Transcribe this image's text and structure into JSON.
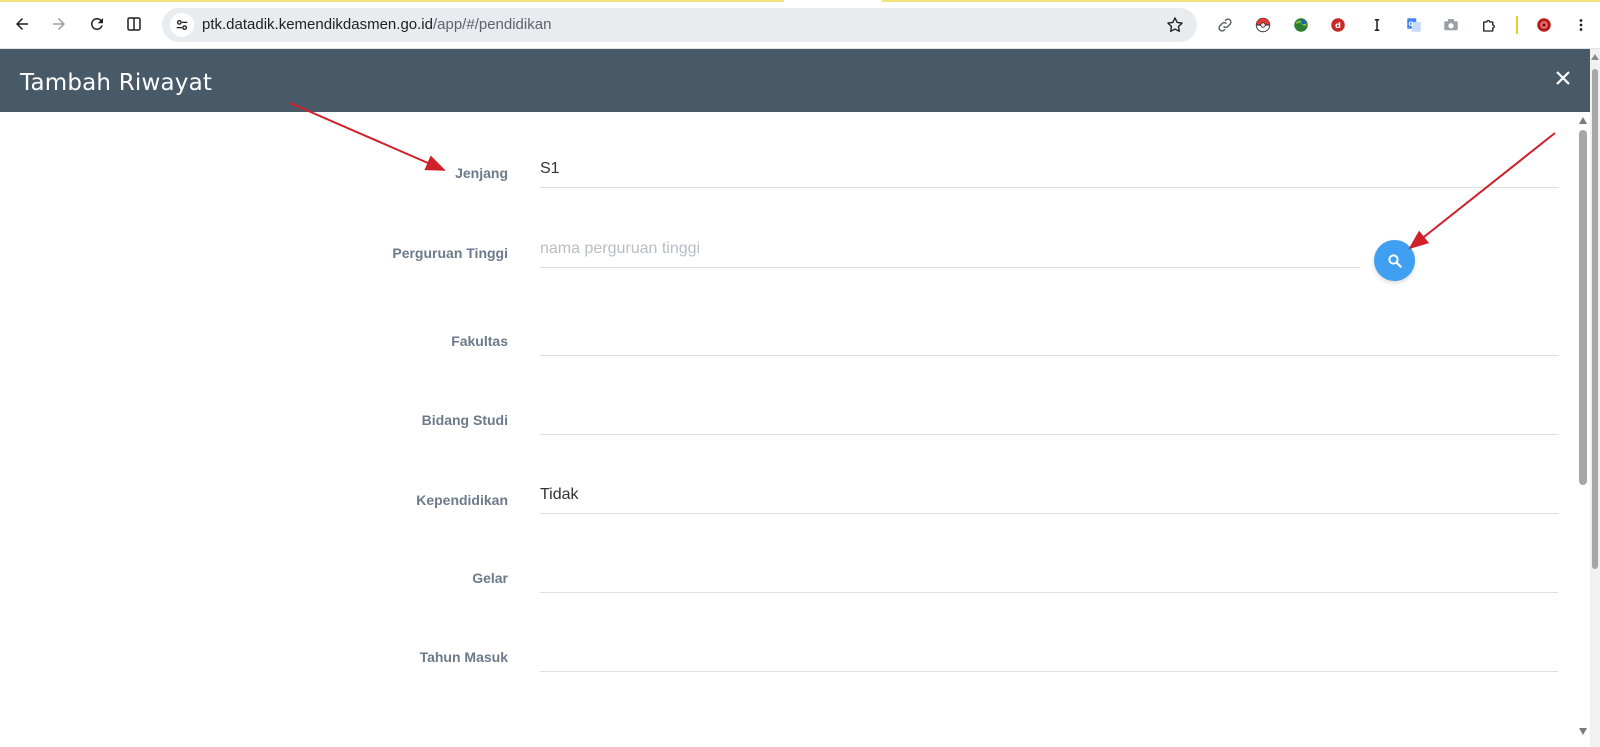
{
  "browser": {
    "url_domain": "ptk.datadik.kemendikdasmen.go.id",
    "url_path": "/app/#/pendidikan",
    "back_icon": "arrow-left-icon",
    "forward_icon": "arrow-right-icon",
    "reload_icon": "reload-icon",
    "split_icon": "split-view-icon",
    "site_info_icon": "tune-icon",
    "bookmark_icon": "star-icon",
    "extensions": [
      "link-icon",
      "pokeball-icon",
      "globe-icon",
      "d-logo-icon",
      "text-cursor-icon",
      "translate-icon",
      "camera-icon",
      "puzzle-icon",
      "profile-icon",
      "menu-kebab-icon"
    ]
  },
  "modal": {
    "title": "Tambah Riwayat",
    "close_icon": "close-icon",
    "header_color": "#485a67"
  },
  "form": {
    "fields": [
      {
        "label": "Jenjang",
        "value": "S1",
        "placeholder": ""
      },
      {
        "label": "Perguruan Tinggi",
        "value": "",
        "placeholder": "nama perguruan tinggi"
      },
      {
        "label": "Fakultas",
        "value": "",
        "placeholder": ""
      },
      {
        "label": "Bidang Studi",
        "value": "",
        "placeholder": ""
      },
      {
        "label": "Kependidikan",
        "value": "Tidak",
        "placeholder": ""
      },
      {
        "label": "Gelar",
        "value": "",
        "placeholder": ""
      },
      {
        "label": "Tahun Masuk",
        "value": "",
        "placeholder": ""
      }
    ],
    "search_button_icon": "search-icon",
    "search_button_color": "#3f9ff0"
  },
  "annotations": {
    "arrow_color": "#d0202a"
  }
}
